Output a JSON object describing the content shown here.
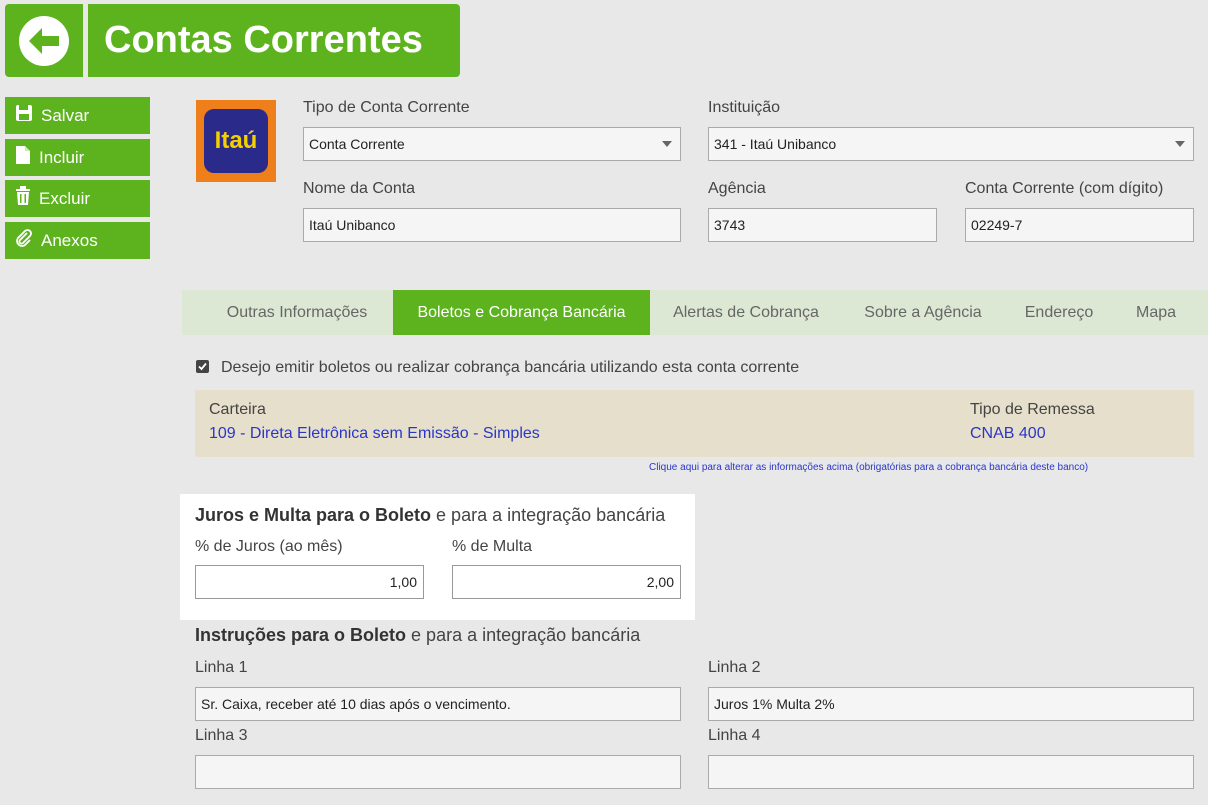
{
  "header": {
    "title": "Contas Correntes",
    "back_icon": "back-arrow-icon"
  },
  "actions": [
    {
      "label": "Salvar",
      "icon": "save-icon"
    },
    {
      "label": "Incluir",
      "icon": "new-file-icon"
    },
    {
      "label": "Excluir",
      "icon": "trash-icon"
    },
    {
      "label": "Anexos",
      "icon": "paperclip-icon"
    }
  ],
  "bank_logo": {
    "text": "Itaú",
    "colors": {
      "outer": "#ef7f1a",
      "inner": "#2a2a8a",
      "text": "#f5d000"
    }
  },
  "form": {
    "tipo_conta": {
      "label": "Tipo de Conta Corrente",
      "value": "Conta Corrente"
    },
    "instituicao": {
      "label": "Instituição",
      "value": "341 - Itaú Unibanco"
    },
    "nome_conta": {
      "label": "Nome da Conta",
      "value": "Itaú Unibanco"
    },
    "agencia": {
      "label": "Agência",
      "value": "3743"
    },
    "conta_corrente": {
      "label": "Conta Corrente (com dígito)",
      "value": "02249-7"
    }
  },
  "tabs": [
    {
      "label": "Outras Informações",
      "active": false
    },
    {
      "label": "Boletos e Cobrança Bancária",
      "active": true
    },
    {
      "label": "Alertas de Cobrança",
      "active": false
    },
    {
      "label": "Sobre a Agência",
      "active": false
    },
    {
      "label": "Endereço",
      "active": false
    },
    {
      "label": "Mapa",
      "active": false
    }
  ],
  "boletos": {
    "checkbox_label": "Desejo emitir boletos ou realizar cobrança bancária utilizando esta conta corrente",
    "checkbox_checked": true,
    "carteira_label": "Carteira",
    "carteira_value": "109 - Direta Eletrônica sem Emissão - Simples",
    "remessa_label": "Tipo de Remessa",
    "remessa_value": "CNAB 400",
    "alterar_link": "Clique aqui para alterar as informações acima (obrigatórias para a cobrança bancária deste banco)"
  },
  "juros_multa": {
    "title_bold": "Juros e Multa para o Boleto",
    "title_rest": " e para a integração bancária",
    "juros_label": "% de Juros (ao mês)",
    "juros_value": "1,00",
    "multa_label": "% de Multa",
    "multa_value": "2,00"
  },
  "instrucoes": {
    "title_bold": "Instruções para o Boleto",
    "title_rest": " e para a integração bancária",
    "linha1_label": "Linha 1",
    "linha1_value": "Sr. Caixa, receber até 10 dias após o vencimento.",
    "linha2_label": "Linha 2",
    "linha2_value": "Juros 1% Multa 2%",
    "linha3_label": "Linha 3",
    "linha3_value": "",
    "linha4_label": "Linha 4",
    "linha4_value": ""
  },
  "colors": {
    "accent": "#5cb31e",
    "link": "#2a36c8",
    "panel_beige": "#e6dfcb",
    "tab_bar": "#dde8d4"
  }
}
